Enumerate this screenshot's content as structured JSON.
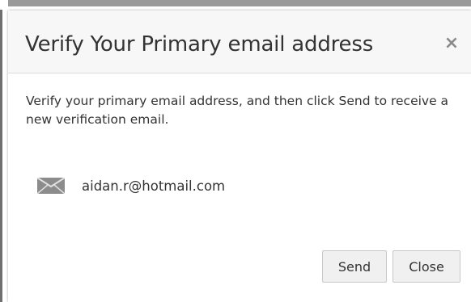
{
  "dialog": {
    "title": "Verify Your Primary email address",
    "close_glyph": "×",
    "instructions": "Verify your primary email address, and then click Send to receive a new verification email.",
    "email": "aidan.r@hotmail.com",
    "email_icon": "envelope-icon",
    "buttons": {
      "send": "Send",
      "close": "Close"
    }
  }
}
